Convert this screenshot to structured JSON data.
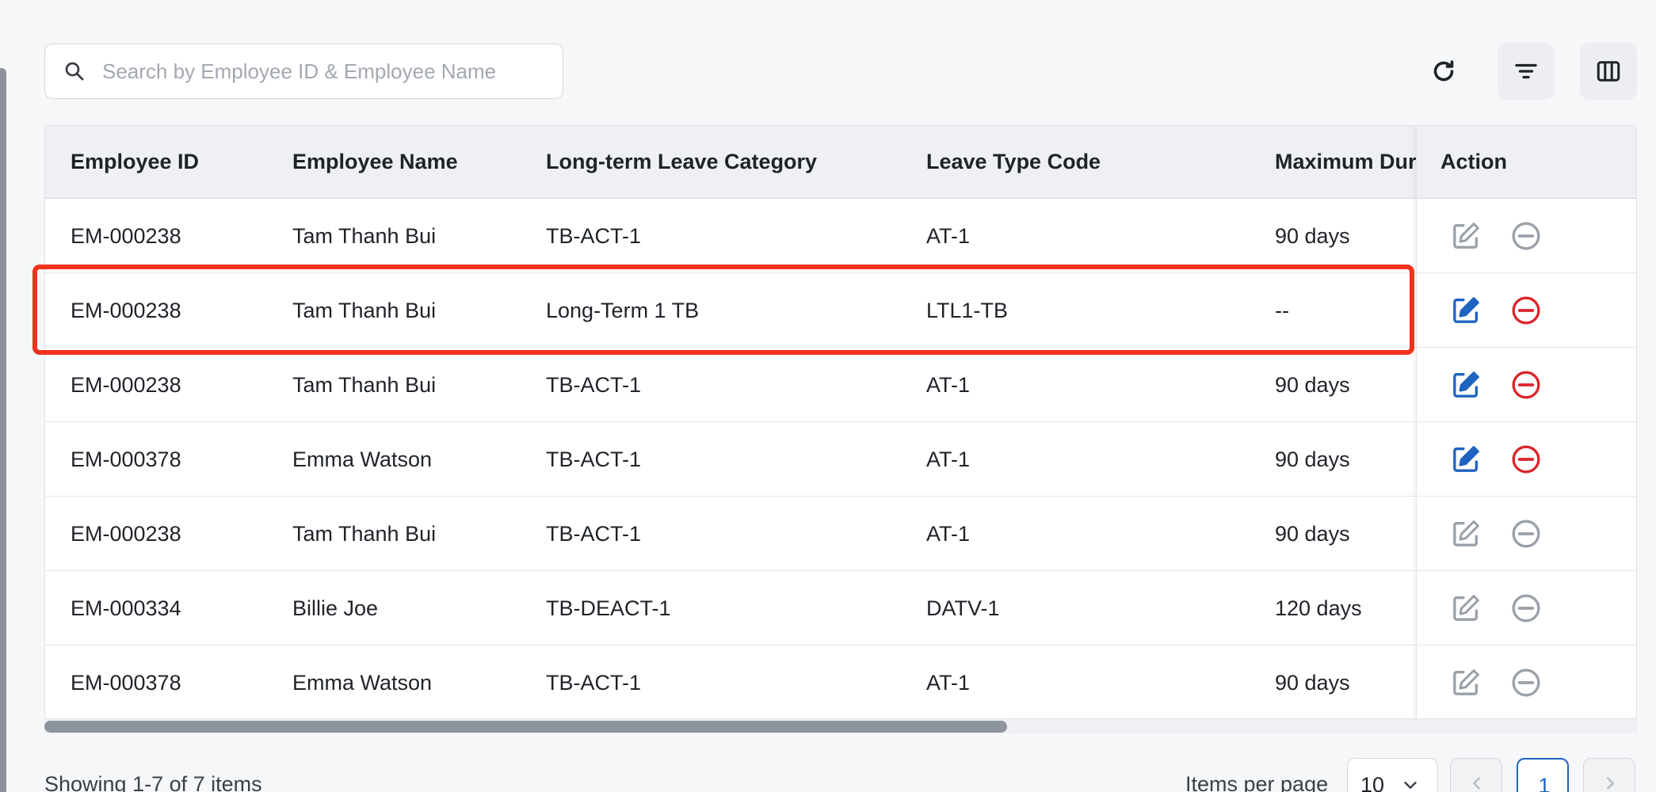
{
  "search": {
    "placeholder": "Search by Employee ID & Employee Name",
    "value": ""
  },
  "toolbar": {
    "refresh_icon": "refresh-icon",
    "filter_icon": "filter-icon",
    "columns_icon": "columns-icon"
  },
  "table": {
    "headers": [
      "Employee ID",
      "Employee Name",
      "Long-term Leave Category",
      "Leave Type Code",
      "Maximum Dur",
      "Action"
    ],
    "rows": [
      {
        "id": "EM-000238",
        "name": "Tam Thanh Bui",
        "category": "TB-ACT-1",
        "code": "AT-1",
        "max": "90 days",
        "active": false
      },
      {
        "id": "EM-000238",
        "name": "Tam Thanh Bui",
        "category": "Long-Term 1 TB",
        "code": "LTL1-TB",
        "max": "--",
        "active": true
      },
      {
        "id": "EM-000238",
        "name": "Tam Thanh Bui",
        "category": "TB-ACT-1",
        "code": "AT-1",
        "max": "90 days",
        "active": true
      },
      {
        "id": "EM-000378",
        "name": "Emma Watson",
        "category": "TB-ACT-1",
        "code": "AT-1",
        "max": "90 days",
        "active": true
      },
      {
        "id": "EM-000238",
        "name": "Tam Thanh Bui",
        "category": "TB-ACT-1",
        "code": "AT-1",
        "max": "90 days",
        "active": false
      },
      {
        "id": "EM-000334",
        "name": "Billie Joe",
        "category": "TB-DEACT-1",
        "code": "DATV-1",
        "max": "120 days",
        "active": false
      },
      {
        "id": "EM-000378",
        "name": "Emma Watson",
        "category": "TB-ACT-1",
        "code": "AT-1",
        "max": "90 days",
        "active": false
      }
    ]
  },
  "colors": {
    "accent_blue": "#1e63c0",
    "danger_red": "#d9262b",
    "disabled_gray": "#9aa0a8",
    "highlight": "#f0331c"
  },
  "footer": {
    "showing": "Showing 1-7 of 7 items",
    "items_per_page_label": "Items per page",
    "items_per_page_value": "10",
    "current_page": "1"
  }
}
